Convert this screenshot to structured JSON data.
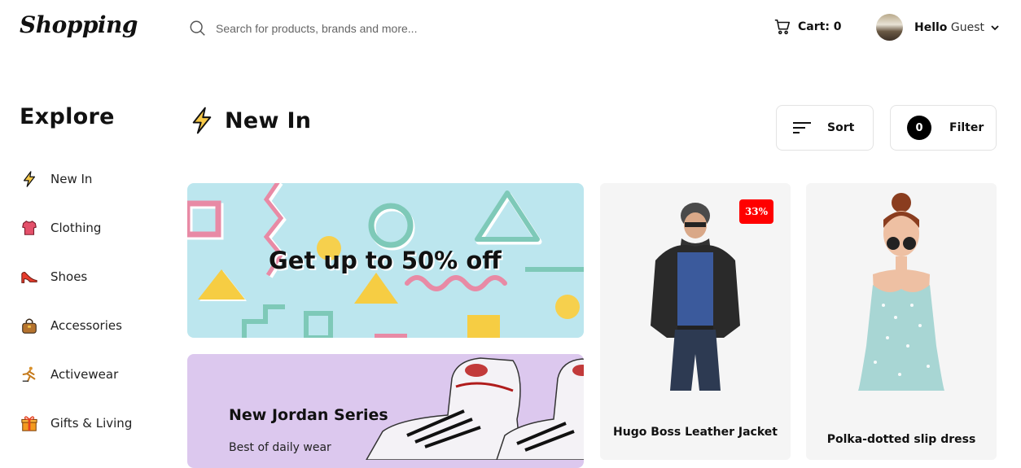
{
  "header": {
    "logo": "Shopping",
    "search_placeholder": "Search for products, brands and more...",
    "cart_label": "Cart: 0",
    "user_hello": "Hello",
    "user_name": "Guest"
  },
  "sidebar": {
    "title": "Explore",
    "items": [
      {
        "label": "New In",
        "icon": "lightning-icon"
      },
      {
        "label": "Clothing",
        "icon": "shirt-icon"
      },
      {
        "label": "Shoes",
        "icon": "heel-shoe-icon"
      },
      {
        "label": "Accessories",
        "icon": "handbag-icon"
      },
      {
        "label": "Activewear",
        "icon": "running-icon"
      },
      {
        "label": "Gifts & Living",
        "icon": "gift-icon"
      }
    ]
  },
  "main": {
    "title": "New In",
    "sort_label": "Sort",
    "filter_label": "Filter",
    "filter_count": "0"
  },
  "banners": {
    "promo_text": "Get up to 50% off",
    "jordan_title": "New Jordan Series",
    "jordan_subtitle": "Best of daily wear"
  },
  "products": [
    {
      "name": "Hugo Boss Leather Jacket",
      "discount": "33%"
    },
    {
      "name": "Polka-dotted slip dress"
    }
  ],
  "colors": {
    "promo_bg": "#bce6ee",
    "jordan_bg": "#dcc8ee",
    "discount_bg": "#ff0000",
    "card_bg": "#f5f5f5"
  }
}
